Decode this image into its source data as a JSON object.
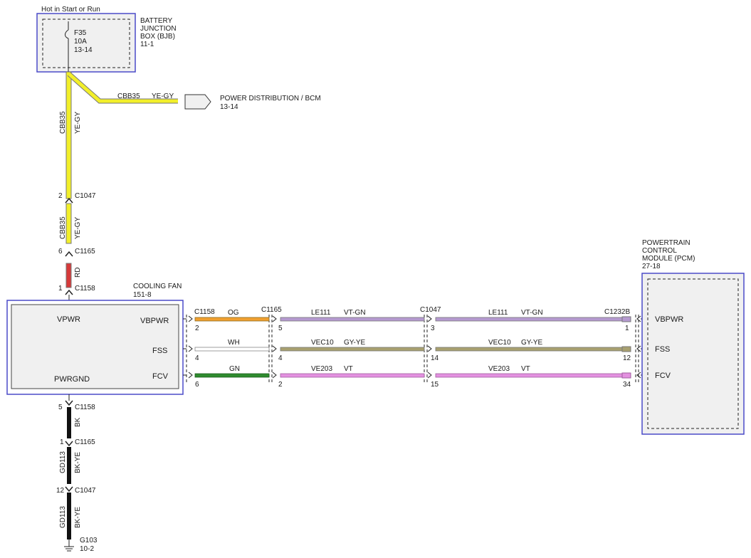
{
  "top_note": "Hot in Start or Run",
  "bjb": {
    "title_lines": [
      "BATTERY",
      "JUNCTION",
      "BOX (BJB)",
      "11-1"
    ],
    "fuse": [
      "F35",
      "10A",
      "13-14"
    ]
  },
  "power_dist": {
    "circuit": "CBB35",
    "color": "YE-GY",
    "label": "POWER DISTRIBUTION / BCM",
    "ref": "13-14"
  },
  "upper_wire": {
    "seg1_circuit": "CBB35",
    "seg1_color": "YE-GY",
    "c1047_pin": "2",
    "c1047": "C1047",
    "seg2_circuit": "CBB35",
    "seg2_color": "YE-GY",
    "c1165_pin": "6",
    "c1165": "C1165",
    "seg3_color": "RD",
    "c1158_pin": "1",
    "c1158": "C1158"
  },
  "cooling_fan": {
    "title": "COOLING FAN",
    "ref": "151-8",
    "vpwr": "VPWR",
    "pwrgnd": "PWRGND",
    "pins": [
      "VBPWR",
      "FSS",
      "FCV"
    ]
  },
  "pcm": {
    "title_lines": [
      "POWERTRAIN",
      "CONTROL",
      "MODULE (PCM)",
      "27-18"
    ],
    "pins": [
      "VBPWR",
      "FSS",
      "FCV"
    ]
  },
  "connectors": {
    "c1158": "C1158",
    "c1165": "C1165",
    "c1047": "C1047",
    "c1232b": "C1232B"
  },
  "wires": [
    {
      "fan_pin": "2",
      "seg_a_color": "OG",
      "c1165_pin": "5",
      "circuit": "LE111",
      "color": "VT-GN",
      "c1047_pin": "3",
      "circuit2": "LE111",
      "color2": "VT-GN",
      "pcm_pin": "1"
    },
    {
      "fan_pin": "4",
      "seg_a_color": "WH",
      "c1165_pin": "4",
      "circuit": "VEC10",
      "color": "GY-YE",
      "c1047_pin": "14",
      "circuit2": "VEC10",
      "color2": "GY-YE",
      "pcm_pin": "12"
    },
    {
      "fan_pin": "6",
      "seg_a_color": "GN",
      "c1165_pin": "2",
      "circuit": "VE203",
      "color": "VT",
      "c1047_pin": "15",
      "circuit2": "VE203",
      "color2": "VT",
      "pcm_pin": "34"
    }
  ],
  "ground": {
    "c1158_pin": "5",
    "c1158": "C1158",
    "seg1_color": "BK",
    "c1165_pin": "1",
    "c1165": "C1165",
    "seg2_circuit": "GD113",
    "seg2_color": "BK-YE",
    "c1047_pin": "12",
    "c1047": "C1047",
    "seg3_circuit": "GD113",
    "seg3_color": "BK-YE",
    "g103": "G103",
    "g103_ref": "10-2"
  },
  "colors": {
    "ye_gy_fill": "#f2ef2a",
    "red": "#d63a3a",
    "orange": "#f0a030",
    "green": "#2e8b2e",
    "violet": "#e391e0",
    "vt_gn_fill": "#b59ad0",
    "gy_ye_fill": "#a8a070",
    "box_border": "#4a4ac8",
    "box_fill": "#f0f0f0"
  }
}
